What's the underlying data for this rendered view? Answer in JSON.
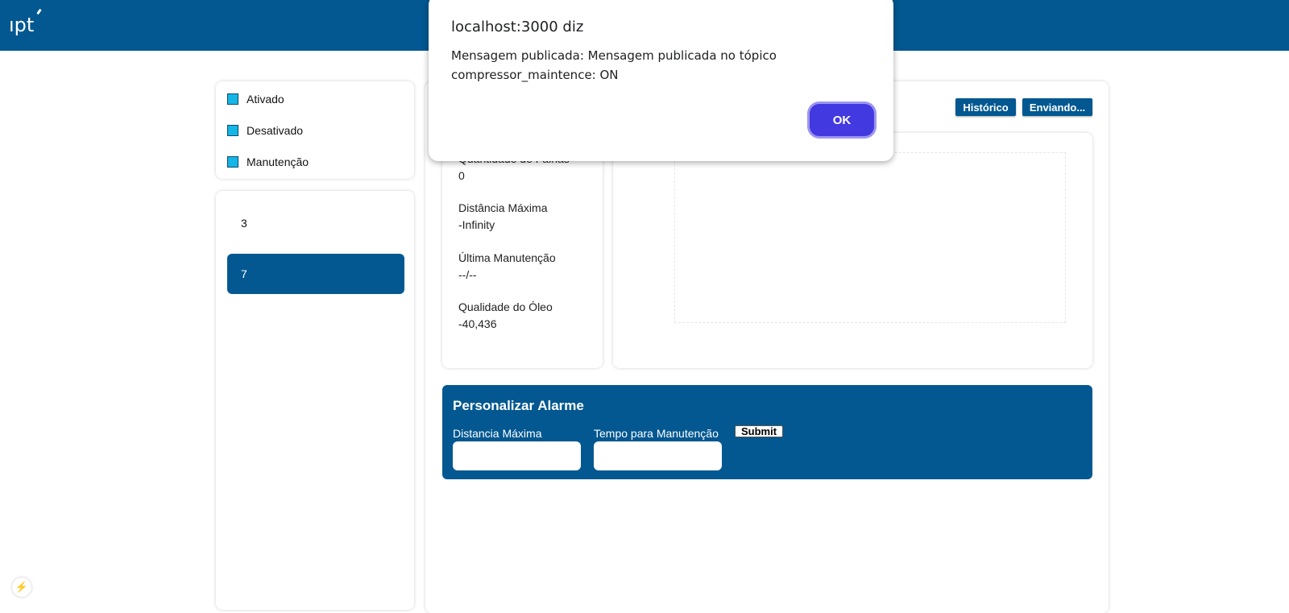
{
  "header": {
    "logo_text": "ıpt",
    "background_color": "#035891"
  },
  "legend": {
    "items": [
      {
        "label": "Ativado",
        "icon": "cyan-square"
      },
      {
        "label": "Desativado",
        "icon": "cyan-square"
      },
      {
        "label": "Manutenção",
        "icon": "cyan-square"
      }
    ],
    "swatch_color": "#15b6e6"
  },
  "devices": {
    "items": [
      {
        "label": "3",
        "selected": false
      },
      {
        "label": "7",
        "selected": true
      }
    ]
  },
  "toolbar": {
    "historico_label": "Histórico",
    "enviando_label": "Enviando..."
  },
  "stats": {
    "quantity_label": "Quantidade de Falhas",
    "quantity_value": "0",
    "distance_label": "Distância Máxima",
    "distance_value": "-Infinity",
    "maintenance_label": "Última Manutenção",
    "maintenance_value": "--/--",
    "oil_label": "Qualidade do Óleo",
    "oil_value": "-40,436"
  },
  "alarm": {
    "title": "Personalizar Alarme",
    "distance_label": "Distancia Máxima",
    "time_label": "Tempo para Manutenção",
    "submit_label": "Submit",
    "distance_value": "",
    "time_value": ""
  },
  "dialog": {
    "title": "localhost:3000 diz",
    "message": "Mensagem publicada: Mensagem publicada no tópico compressor_maintence: ON",
    "ok_label": "OK",
    "ok_color": "#4339e0"
  },
  "footer": {
    "bolt_icon": "lightning-icon"
  }
}
